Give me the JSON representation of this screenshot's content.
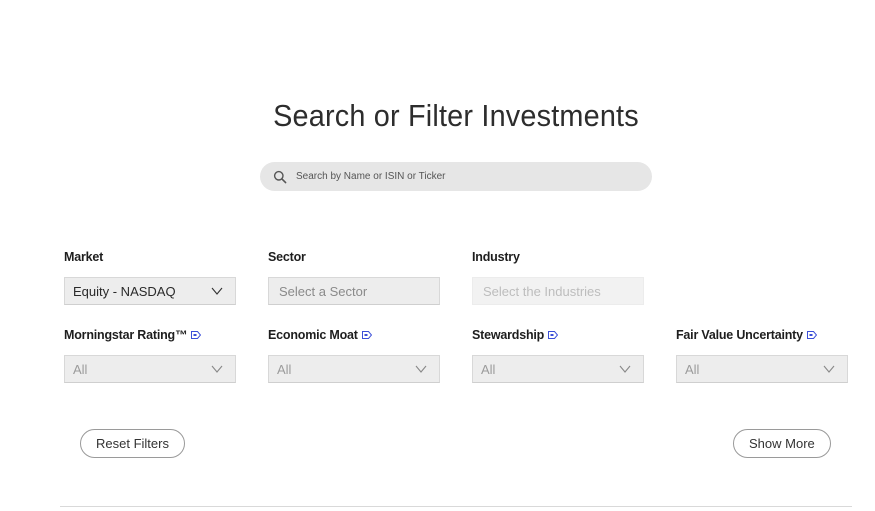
{
  "page": {
    "title": "Search or Filter Investments",
    "search_placeholder": "Search by Name or ISIN or Ticker"
  },
  "filters": {
    "market": {
      "label": "Market",
      "value": "Equity - NASDAQ"
    },
    "sector": {
      "label": "Sector",
      "value": "Select a Sector"
    },
    "industry": {
      "label": "Industry",
      "value": "Select the Industries"
    },
    "rating": {
      "label": "Morningstar Rating™",
      "value": "All"
    },
    "moat": {
      "label": "Economic Moat",
      "value": "All"
    },
    "stewardship": {
      "label": "Stewardship",
      "value": "All"
    },
    "uncertainty": {
      "label": "Fair Value Uncertainty",
      "value": "All"
    }
  },
  "actions": {
    "reset": "Reset Filters",
    "show_more": "Show More"
  },
  "colors": {
    "info_icon": "#3b4fd8",
    "select_bg": "#ededed",
    "search_bg": "#e6e6e6"
  },
  "icons": {
    "search": "search-icon",
    "dropdown": "chevron-down-icon",
    "info": "info-tag-icon"
  }
}
